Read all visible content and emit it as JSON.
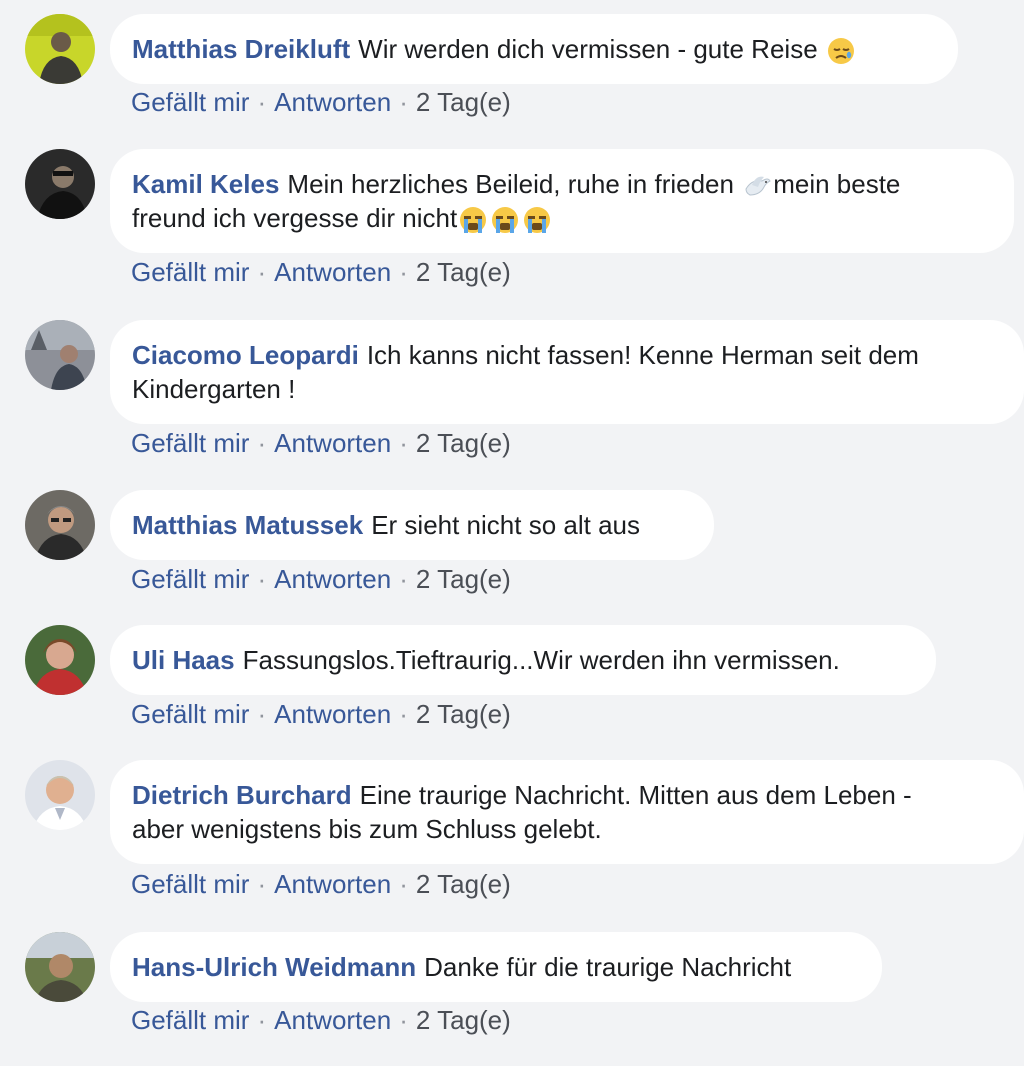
{
  "comments": [
    {
      "author": "Matthias Dreikluft",
      "text": "Wir werden dich vermissen - gute Reise",
      "emoji_after": [
        "sad-tear-emoji"
      ],
      "like_label": "Gefällt mir",
      "reply_label": "Antworten",
      "time": "2 Tag(e)",
      "avatar_colors": {
        "bg": "#c8d62a",
        "face": "#6a5a48",
        "body": "#3a3a35"
      }
    },
    {
      "author": "Kamil Keles",
      "text_before": "Mein herzliches Beileid, ruhe in frieden ",
      "text_middle": "mein beste",
      "text_line2": "freund ich vergesse dir nicht",
      "emoji_inline": [
        "dove-emoji"
      ],
      "emoji_after": [
        "crying-emoji",
        "crying-emoji",
        "crying-emoji"
      ],
      "like_label": "Gefällt mir",
      "reply_label": "Antworten",
      "time": "2 Tag(e)",
      "avatar_colors": {
        "bg": "#2a2a2a",
        "face": "#8a7a6a",
        "body": "#111111"
      }
    },
    {
      "author": "Ciacomo Leopardi",
      "text": "Ich kanns nicht fassen! Kenne Herman seit dem",
      "text_line2": "Kindergarten !",
      "like_label": "Gefällt mir",
      "reply_label": "Antworten",
      "time": "2 Tag(e)",
      "avatar_colors": {
        "bg": "#8d9098",
        "face": "#a08070",
        "body": "#3d4450"
      }
    },
    {
      "author": "Matthias Matussek",
      "text": "Er sieht nicht so alt aus",
      "like_label": "Gefällt mir",
      "reply_label": "Antworten",
      "time": "2 Tag(e)",
      "avatar_colors": {
        "bg": "#6d6a64",
        "face": "#c09a80",
        "body": "#2a2a2a"
      }
    },
    {
      "author": "Uli Haas",
      "text": "Fassungslos.Tieftraurig...Wir werden ihn vermissen.",
      "like_label": "Gefällt mir",
      "reply_label": "Antworten",
      "time": "2 Tag(e)",
      "avatar_colors": {
        "bg": "#4a6a3a",
        "face": "#d8a890",
        "body": "#c03030"
      }
    },
    {
      "author": "Dietrich Burchard",
      "text": "Eine traurige Nachricht. Mitten aus dem Leben -",
      "text_line2": "aber wenigstens bis zum Schluss gelebt.",
      "like_label": "Gefällt mir",
      "reply_label": "Antworten",
      "time": "2 Tag(e)",
      "avatar_colors": {
        "bg": "#dfe3ea",
        "face": "#e0b090",
        "body": "#ffffff"
      }
    },
    {
      "author": "Hans-Ulrich Weidmann",
      "text": "Danke für die traurige Nachricht",
      "like_label": "Gefällt mir",
      "reply_label": "Antworten",
      "time": "2 Tag(e)",
      "avatar_colors": {
        "bg": "#6a7a4a",
        "face": "#b08868",
        "body": "#4a4a3a"
      }
    }
  ],
  "separator": "·",
  "colors": {
    "page_bg": "#f2f3f5",
    "bubble_bg": "#ffffff",
    "author_link": "#385898",
    "body_text": "#1c1e21",
    "meta_text": "#4b4f56"
  }
}
